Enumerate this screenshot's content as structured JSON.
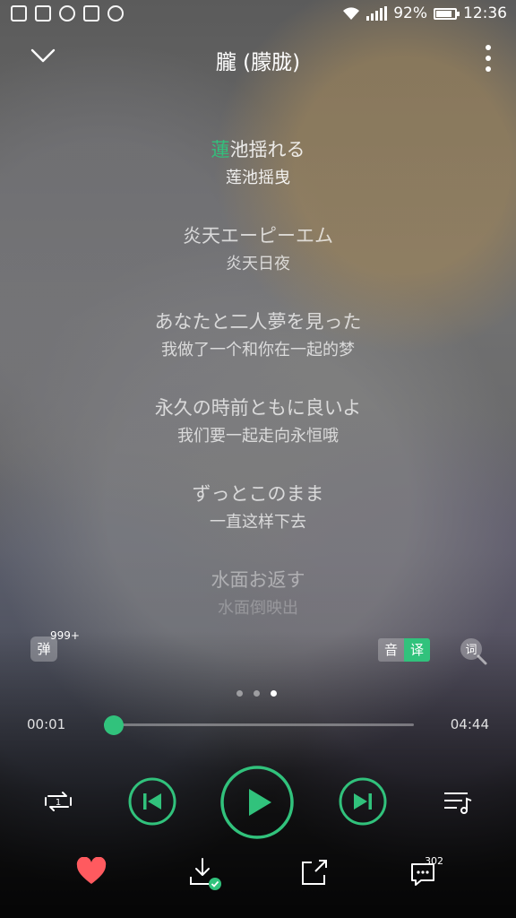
{
  "status_bar": {
    "battery": "92%",
    "time": "12:36",
    "left_icons": [
      "trash-icon",
      "app-icon",
      "shield-icon",
      "sim-icon",
      "weather-icon"
    ],
    "right_icons": [
      "wifi-icon",
      "signal-icon",
      "battery-icon"
    ]
  },
  "header": {
    "title": "朧 (朦胧)"
  },
  "lyrics": [
    {
      "line_hl": "蓮",
      "line_rest": "池揺れる",
      "trans": "莲池摇曳"
    },
    {
      "line_hl": "",
      "line_rest": "炎天エーピーエム",
      "trans": "炎天日夜"
    },
    {
      "line_hl": "",
      "line_rest": "あなたと二人夢を見った",
      "trans": "我做了一个和你在一起的梦"
    },
    {
      "line_hl": "",
      "line_rest": "永久の時前ともに良いよ",
      "trans": "我们要一起走向永恒哦"
    },
    {
      "line_hl": "",
      "line_rest": "ずっとこのまま",
      "trans": "一直这样下去"
    },
    {
      "line_hl": "",
      "line_rest": "水面お返す",
      "trans": "水面倒映出"
    }
  ],
  "options": {
    "danmu_label": "弹",
    "danmu_count": "999+",
    "toggle_original": "音",
    "toggle_translation": "译",
    "search_lyrics_icon": "search-lyrics-icon"
  },
  "pager": {
    "total": 3,
    "active_index": 3
  },
  "player": {
    "elapsed": "00:01",
    "duration": "04:44",
    "progress_fraction": 0.003,
    "accent_color": "#31c27c"
  },
  "bottom": {
    "comment_count": "302",
    "liked_color": "#ff5a5f"
  }
}
